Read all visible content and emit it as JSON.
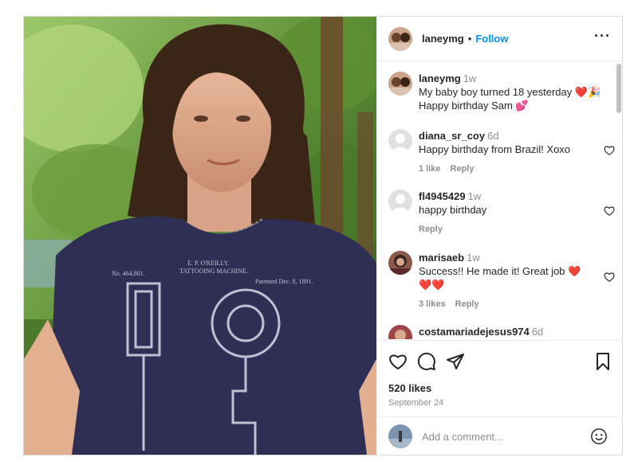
{
  "post": {
    "author": "laneymg",
    "follow_label": "Follow",
    "separator": "•",
    "more_label": "···",
    "caption": {
      "user": "laneymg",
      "time": "1w",
      "line1": "My baby boy turned 18 yesterday ",
      "line1_emoji": "❤️🎉",
      "line2": "Happy birthday Sam ",
      "line2_emoji": "💕"
    },
    "comments": [
      {
        "user": "diana_sr_coy",
        "time": "6d",
        "text": "Happy birthday from Brazil! Xoxo",
        "likes": "1 like",
        "reply": "Reply"
      },
      {
        "user": "fl4945429",
        "time": "1w",
        "text": "happy birthday",
        "reply": "Reply"
      },
      {
        "user": "marisaeb",
        "time": "1w",
        "text": "Success!! He made it! Great job ",
        "text_emoji": "❤️",
        "text_line2_emoji": "❤️❤️",
        "likes": "3 likes",
        "reply": "Reply"
      },
      {
        "user": "costamariadejesus974",
        "time": "6d"
      }
    ],
    "like_count": "520 likes",
    "date": "September 24",
    "comment_placeholder": "Add a comment...",
    "icons": [
      "heart-icon",
      "comment-icon",
      "share-icon",
      "bookmark-icon",
      "emoji-icon",
      "more-icon"
    ],
    "colors": {
      "follow": "#0095f6",
      "muted": "#8e8e8e",
      "border": "#dbdbdb",
      "heart": "#ed4956"
    }
  }
}
